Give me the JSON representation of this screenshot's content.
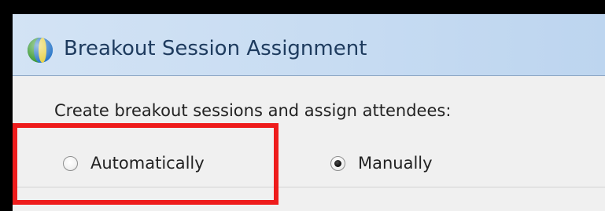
{
  "window": {
    "title": "Breakout Session Assignment",
    "icon": "globe-icon"
  },
  "form": {
    "prompt": "Create breakout sessions and assign attendees:",
    "options": [
      {
        "label": "Automatically",
        "selected": false
      },
      {
        "label": "Manually",
        "selected": true
      }
    ]
  },
  "annotation": {
    "highlight_color": "#ee1c1c",
    "highlights": "Automatically"
  },
  "colors": {
    "titlebar": "#c6dbf2",
    "title_text": "#1e3b5e",
    "background": "#f0f0f0"
  }
}
